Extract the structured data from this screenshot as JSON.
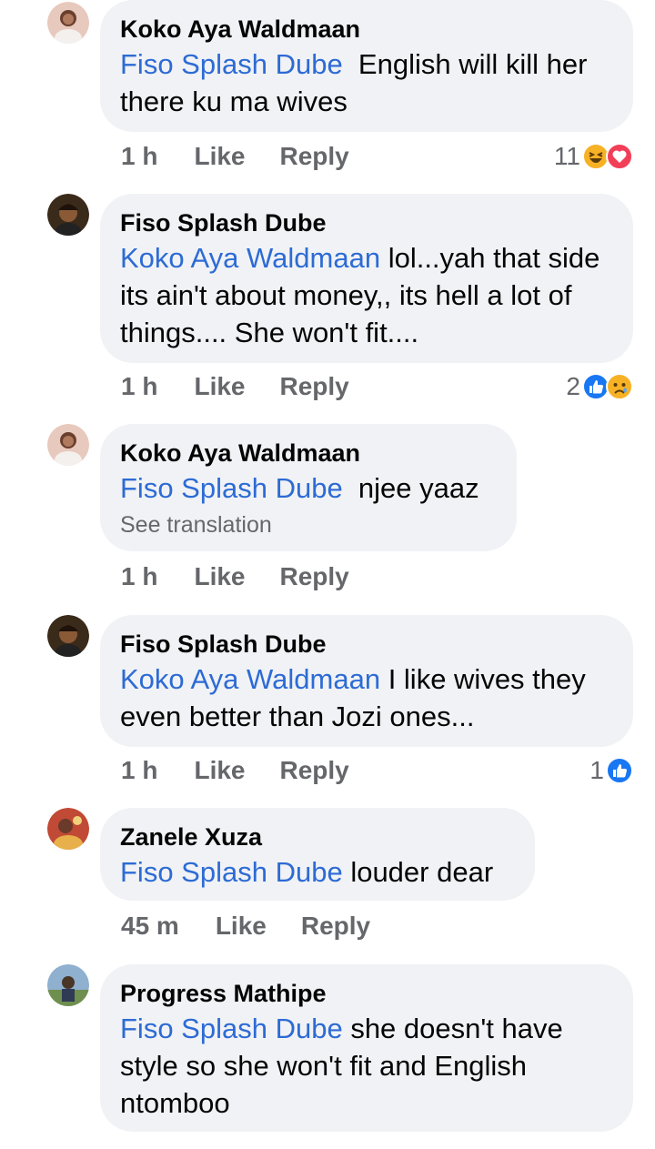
{
  "comments": [
    {
      "author": "Koko Aya Waldmaan",
      "mention": "Fiso Splash Dube",
      "text": "English will kill her there ku ma wives",
      "time": "1 h",
      "like": "Like",
      "reply": "Reply",
      "reaction_count": "11",
      "reactions": [
        "haha-icon",
        "love-icon"
      ],
      "avatar_color": "#c58a7a"
    },
    {
      "author": "Fiso Splash Dube",
      "mention": "Koko Aya Waldmaan",
      "text": "lol...yah that side its ain't about money,, its hell a lot of things.... She won't fit....",
      "time": "1 h",
      "like": "Like",
      "reply": "Reply",
      "reaction_count": "2",
      "reactions": [
        "like-icon",
        "sad-icon"
      ],
      "avatar_color": "#5a3a22"
    },
    {
      "author": "Koko Aya Waldmaan",
      "mention": "Fiso Splash Dube",
      "text": "njee yaaz",
      "see_translation": "See translation",
      "time": "1 h",
      "like": "Like",
      "reply": "Reply",
      "avatar_color": "#c58a7a"
    },
    {
      "author": "Fiso Splash Dube",
      "mention": "Koko Aya Waldmaan",
      "text": "I like wives they even better than Jozi ones...",
      "time": "1 h",
      "like": "Like",
      "reply": "Reply",
      "reaction_count": "1",
      "reactions": [
        "like-icon"
      ],
      "avatar_color": "#5a3a22"
    },
    {
      "author": "Zanele Xuza",
      "mention": "Fiso Splash Dube",
      "text": "louder dear",
      "time": "45 m",
      "like": "Like",
      "reply": "Reply",
      "avatar_color": "#a23b2e"
    },
    {
      "author": "Progress Mathipe",
      "mention": "Fiso Splash Dube",
      "text": "she doesn't have style so she won't fit and English ntomboo",
      "avatar_color": "#6f8fae"
    }
  ],
  "colors": {
    "mention": "#2d6bd4",
    "bubble": "#f0f2f5",
    "meta": "#65676b",
    "like_blue": "#1877f2",
    "love_red": "#f33e58",
    "haha_yellow": "#f7b125"
  }
}
